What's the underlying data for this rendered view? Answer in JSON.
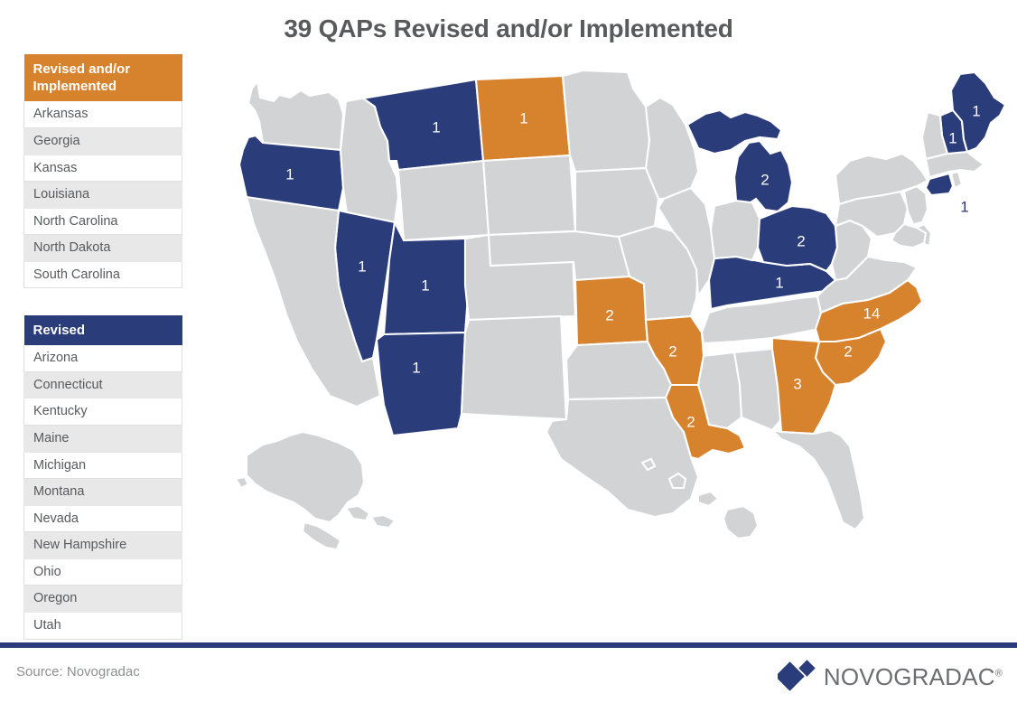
{
  "title": "39 QAPs Revised and/or Implemented",
  "legend": {
    "implemented": {
      "header": "Revised and/or Implemented",
      "color": "#d7822c",
      "states": [
        "Arkansas",
        "Georgia",
        "Kansas",
        "Louisiana",
        "North Carolina",
        "North Dakota",
        "South Carolina"
      ]
    },
    "revised": {
      "header": "Revised",
      "color": "#2b3c7b",
      "states": [
        "Arizona",
        "Connecticut",
        "Kentucky",
        "Maine",
        "Michigan",
        "Montana",
        "Nevada",
        "New Hampshire",
        "Ohio",
        "Oregon",
        "Utah"
      ]
    }
  },
  "map": {
    "colors": {
      "navy": "#2b3c7b",
      "orange": "#d7822c",
      "inactive": "#d2d3d5",
      "border": "#ffffff"
    },
    "labels": {
      "MT": "1",
      "ND": "1",
      "OR": "1",
      "NV": "1",
      "UT": "1",
      "AZ": "1",
      "KS": "2",
      "AR": "2",
      "LA": "2",
      "GA": "3",
      "SC": "2",
      "NC": "14",
      "KY": "1",
      "OH": "2",
      "MI": "2",
      "ME": "1",
      "NH": "1",
      "CT": "1"
    }
  },
  "footer": {
    "source": "Source: Novogradac",
    "brand_name": "NOVOGRADAC",
    "brand_registered": "®"
  },
  "chart_data": {
    "type": "map",
    "title": "39 QAPs Revised and/or Implemented",
    "total": 39,
    "categories": [
      "Revised and/or Implemented",
      "Revised"
    ],
    "series": [
      {
        "name": "Revised and/or Implemented",
        "color": "#d7822c",
        "points": [
          {
            "state": "Arkansas",
            "code": "AR",
            "value": 2
          },
          {
            "state": "Georgia",
            "code": "GA",
            "value": 3
          },
          {
            "state": "Kansas",
            "code": "KS",
            "value": 2
          },
          {
            "state": "Louisiana",
            "code": "LA",
            "value": 2
          },
          {
            "state": "North Carolina",
            "code": "NC",
            "value": 14
          },
          {
            "state": "North Dakota",
            "code": "ND",
            "value": 1
          },
          {
            "state": "South Carolina",
            "code": "SC",
            "value": 2
          }
        ]
      },
      {
        "name": "Revised",
        "color": "#2b3c7b",
        "points": [
          {
            "state": "Arizona",
            "code": "AZ",
            "value": 1
          },
          {
            "state": "Connecticut",
            "code": "CT",
            "value": 1
          },
          {
            "state": "Kentucky",
            "code": "KY",
            "value": 1
          },
          {
            "state": "Maine",
            "code": "ME",
            "value": 1
          },
          {
            "state": "Michigan",
            "code": "MI",
            "value": 2
          },
          {
            "state": "Montana",
            "code": "MT",
            "value": 1
          },
          {
            "state": "Nevada",
            "code": "NV",
            "value": 1
          },
          {
            "state": "New Hampshire",
            "code": "NH",
            "value": 1
          },
          {
            "state": "Ohio",
            "code": "OH",
            "value": 2
          },
          {
            "state": "Oregon",
            "code": "OR",
            "value": 1
          },
          {
            "state": "Utah",
            "code": "UT",
            "value": 1
          }
        ]
      }
    ],
    "legend_position": "left",
    "xlabel": "",
    "ylabel": ""
  }
}
